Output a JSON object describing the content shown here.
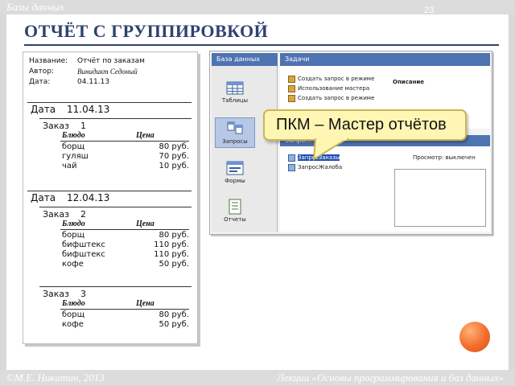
{
  "slide": {
    "top_label": "Базы данных",
    "page_number": "23",
    "title": "ОТЧЁТ С ГРУППИРОВКОЙ",
    "footer_left": "©М.Е. Никитин, 2013",
    "footer_right": "Лекции «Основы программирования и баз данных»"
  },
  "report": {
    "header": [
      {
        "key": "Название:",
        "value": "Отчёт по заказам"
      },
      {
        "key": "Автор:",
        "value": "Винидикт Седоный"
      },
      {
        "key": "Дата:",
        "value": "04.11.13"
      }
    ],
    "date_label": "Дата",
    "order_label": "Заказ",
    "col_dish": "Блюдо",
    "col_price": "Цена",
    "groups": [
      {
        "date": "11.04.13",
        "orders": [
          {
            "number": "1",
            "items": [
              {
                "dish": "борщ",
                "price": "80 руб."
              },
              {
                "dish": "гуляш",
                "price": "70 руб."
              },
              {
                "dish": "чай",
                "price": "10 руб."
              }
            ]
          }
        ]
      },
      {
        "date": "12.04.13",
        "orders": [
          {
            "number": "2",
            "items": [
              {
                "dish": "борщ",
                "price": "80 руб."
              },
              {
                "dish": "бифштекс",
                "price": "110 руб."
              },
              {
                "dish": "бифштекс",
                "price": "110 руб."
              },
              {
                "dish": "кофе",
                "price": "50 руб."
              }
            ]
          },
          {
            "number": "3",
            "items": [
              {
                "dish": "борщ",
                "price": "80 руб."
              },
              {
                "dish": "кофе",
                "price": "50 руб."
              }
            ]
          }
        ]
      }
    ]
  },
  "access": {
    "nav_header": "База данных",
    "nav_items": [
      {
        "label": "Таблицы",
        "icon": "table-icon"
      },
      {
        "label": "Запросы",
        "icon": "query-icon"
      },
      {
        "label": "Формы",
        "icon": "form-icon"
      },
      {
        "label": "Отчеты",
        "icon": "report-icon"
      }
    ],
    "tasks_header": "Задачи",
    "tasks": [
      "Создать запрос в режиме",
      "Использование мастера",
      "Создать запрос в режиме"
    ],
    "description_label": "Описание",
    "objects": [
      "ЗапросЗаказы",
      "ЗапросЖалоба"
    ],
    "objects_header": "Запро...",
    "preview_label": "Просмотр: выключен"
  },
  "callout": {
    "text": "ПКМ – Мастер отчётов"
  },
  "colors": {
    "title": "#2f4170",
    "pane_header": "#4e73b1",
    "callout_bg": "#fff6b4",
    "accent_ball": "#f36d2a"
  }
}
